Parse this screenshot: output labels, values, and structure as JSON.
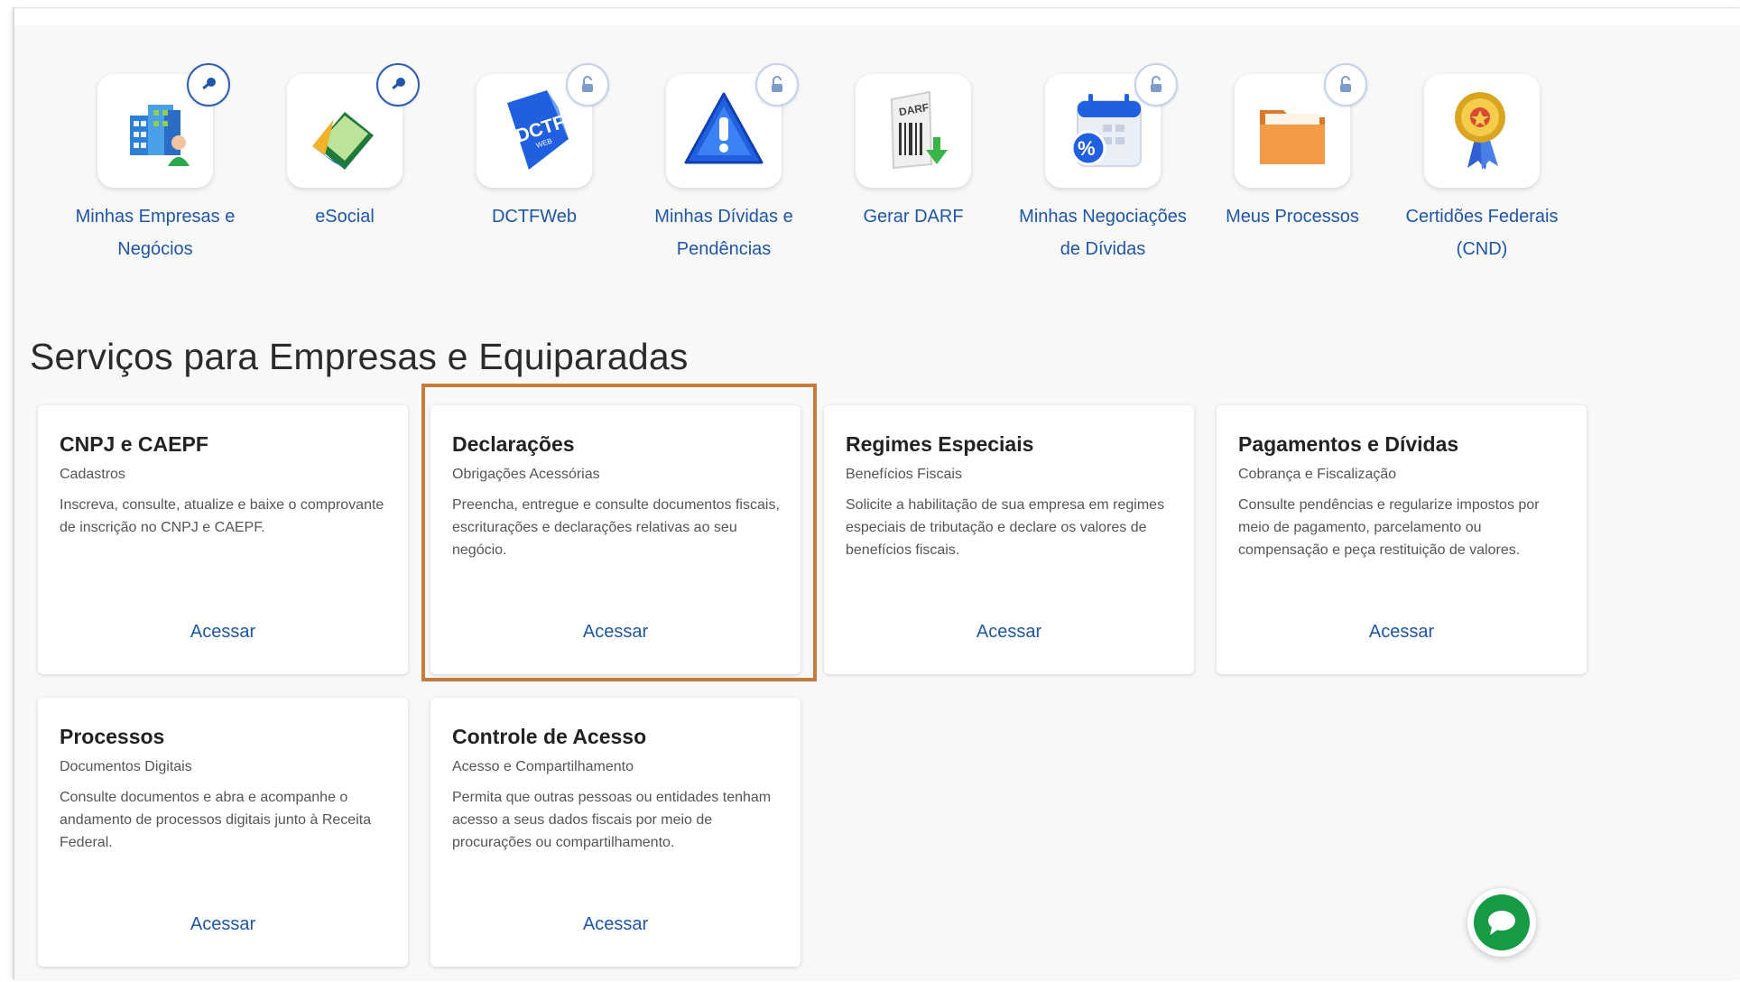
{
  "quick_access": [
    {
      "label": "Minhas Empresas e Negócios",
      "icon": "buildings-icon",
      "badge": "key-icon"
    },
    {
      "label": "eSocial",
      "icon": "esocial-icon",
      "badge": "key-icon"
    },
    {
      "label": "DCTFWeb",
      "icon": "dctf-document-icon",
      "icon_text": "DCTF",
      "icon_subtext": "WEB",
      "badge": "lock-icon"
    },
    {
      "label": "Minhas Dívidas e Pendências",
      "icon": "warning-icon",
      "badge": "lock-icon"
    },
    {
      "label": "Gerar DARF",
      "icon": "darf-barcode-icon",
      "icon_text": "DARF"
    },
    {
      "label": "Minhas Negociações de Dívidas",
      "icon": "calendar-percent-icon",
      "badge": "lock-icon"
    },
    {
      "label": "Meus Processos",
      "icon": "folder-icon",
      "badge": "lock-icon"
    },
    {
      "label": "Certidões Federais (CND)",
      "icon": "medal-icon"
    }
  ],
  "section_title": "Serviços para Empresas e Equiparadas",
  "cards": [
    {
      "title": "CNPJ e CAEPF",
      "subtitle": "Cadastros",
      "description": "Inscreva, consulte, atualize e baixe o comprovante de inscrição no CNPJ e CAEPF.",
      "action": "Acessar"
    },
    {
      "title": "Declarações",
      "subtitle": "Obrigações Acessórias",
      "description": "Preencha, entregue e consulte documentos fiscais, escriturações e declarações relativas ao seu negócio.",
      "action": "Acessar"
    },
    {
      "title": "Regimes Especiais",
      "subtitle": "Benefícios Fiscais",
      "description": "Solicite a habilitação de sua empresa em regimes especiais de tributação e declare os valores de benefícios fiscais.",
      "action": "Acessar"
    },
    {
      "title": "Pagamentos e Dívidas",
      "subtitle": "Cobrança e Fiscalização",
      "description": "Consulte pendências e regularize impostos por meio de pagamento, parcelamento ou compensação e peça restituição de valores.",
      "action": "Acessar"
    },
    {
      "title": "Processos",
      "subtitle": "Documentos Digitais",
      "description": "Consulte documentos e abra e acompanhe o andamento de processos digitais junto à Receita Federal.",
      "action": "Acessar"
    },
    {
      "title": "Controle de Acesso",
      "subtitle": "Acesso e Compartilhamento",
      "description": "Permita que outras pessoas ou entidades tenham acesso a seus dados fiscais por meio de procurações ou compartilhamento.",
      "action": "Acessar"
    }
  ],
  "colors": {
    "link": "#1e56a8",
    "highlight": "#c87a3a",
    "chat": "#169c45"
  },
  "chat_button_icon": "chat-bubble-icon"
}
